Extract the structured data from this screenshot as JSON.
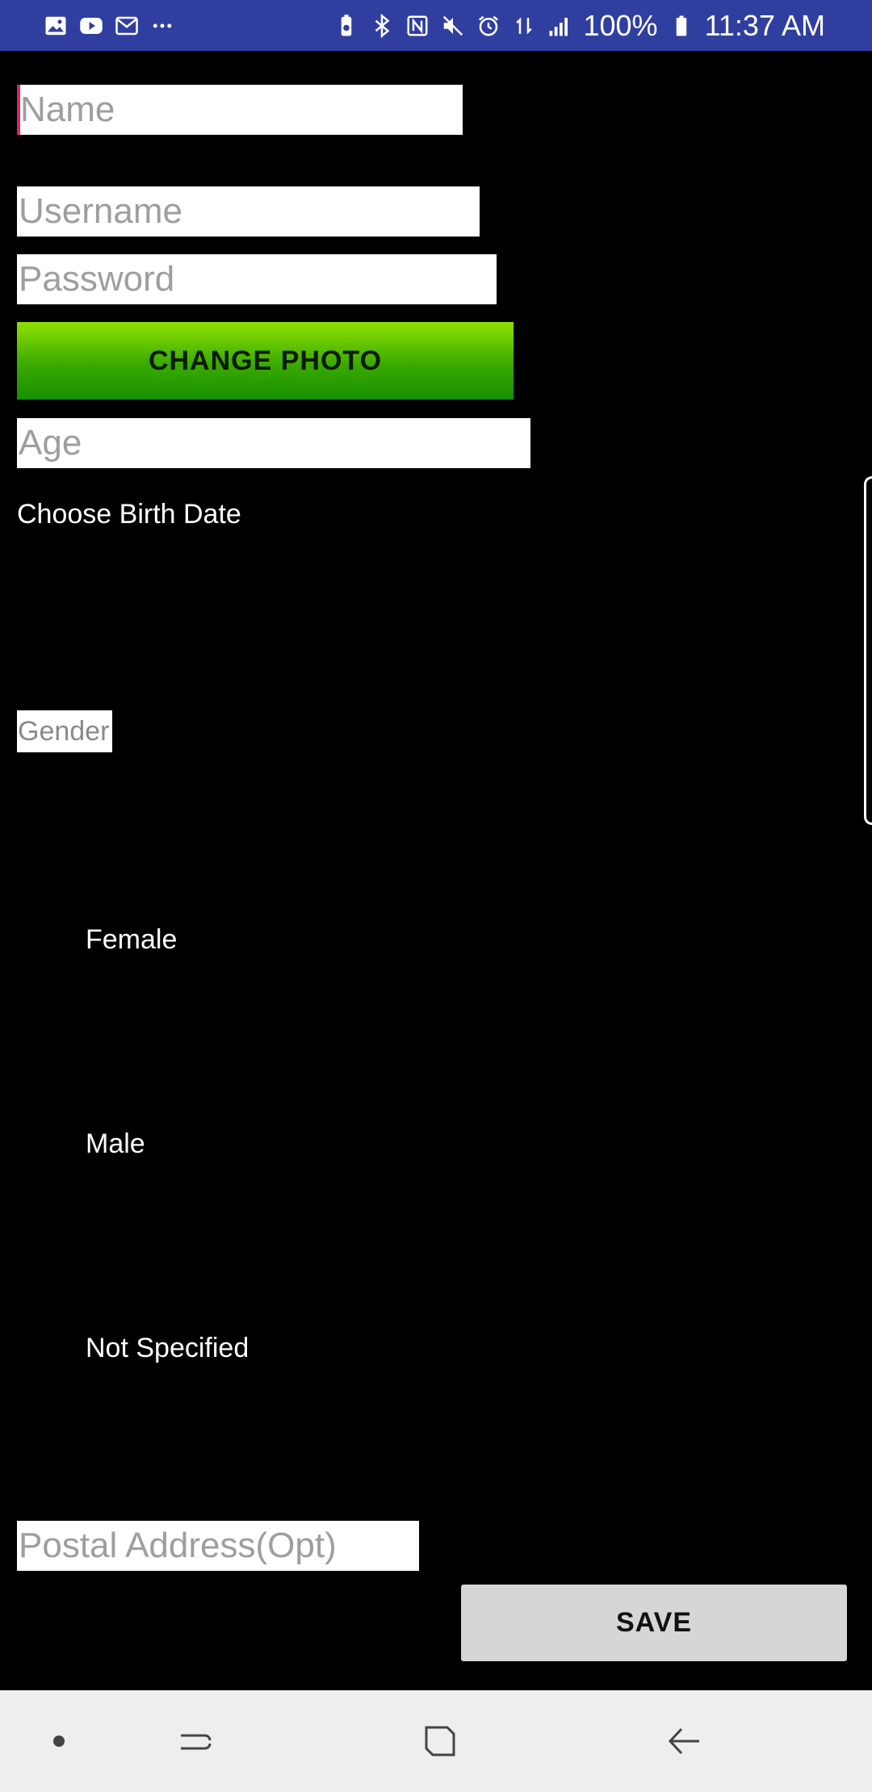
{
  "status_bar": {
    "battery": "100%",
    "time": "11:37 AM",
    "left_icons": [
      "gallery-icon",
      "youtube-icon",
      "email-icon",
      "more-icon"
    ],
    "right_icons": [
      "battery-saver-icon",
      "bluetooth-icon",
      "nfc-icon",
      "mute-icon",
      "alarm-icon",
      "data-icon",
      "signal-icon",
      "battery-icon"
    ]
  },
  "form": {
    "name_placeholder": "Name",
    "username_placeholder": "Username",
    "password_placeholder": "Password",
    "change_photo_label": "CHANGE PHOTO",
    "age_placeholder": "Age",
    "birth_date_label": "Choose Birth Date",
    "gender_label": "Gender",
    "gender_options": [
      "Female",
      "Male",
      "Not Specified"
    ],
    "postal_placeholder": "Postal Address(Opt)",
    "save_label": "SAVE"
  },
  "nav_bar": {
    "icons": [
      "dot-icon",
      "recents-icon",
      "home-icon",
      "back-icon"
    ]
  },
  "colors": {
    "status_bar": "#303F9F",
    "accent_cursor": "#E91E63",
    "change_photo_green": "#3AAA00",
    "save_button": "#D6D6D6"
  }
}
